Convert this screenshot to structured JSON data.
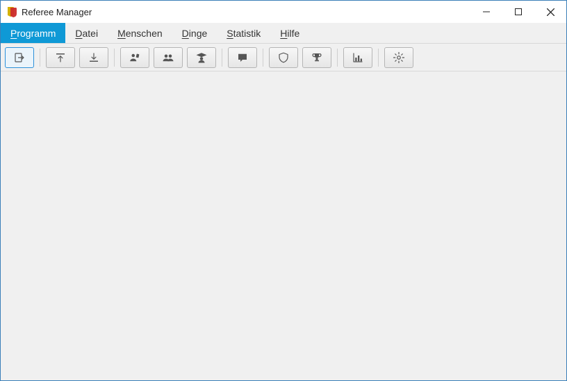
{
  "window": {
    "title": "Referee Manager"
  },
  "menu": {
    "items": [
      {
        "label": "Programm",
        "mnemonic": "P",
        "active": true
      },
      {
        "label": "Datei",
        "mnemonic": "D",
        "active": false
      },
      {
        "label": "Menschen",
        "mnemonic": "M",
        "active": false
      },
      {
        "label": "Dinge",
        "mnemonic": "D",
        "active": false
      },
      {
        "label": "Statistik",
        "mnemonic": "S",
        "active": false
      },
      {
        "label": "Hilfe",
        "mnemonic": "H",
        "active": false
      }
    ]
  },
  "toolbar": {
    "groups": [
      [
        {
          "name": "exit",
          "selected": true
        }
      ],
      [
        {
          "name": "upload"
        },
        {
          "name": "download"
        }
      ],
      [
        {
          "name": "referees"
        },
        {
          "name": "people"
        },
        {
          "name": "trainees"
        }
      ],
      [
        {
          "name": "messages"
        }
      ],
      [
        {
          "name": "shield"
        },
        {
          "name": "trophy"
        }
      ],
      [
        {
          "name": "statistics"
        }
      ],
      [
        {
          "name": "settings"
        }
      ]
    ]
  }
}
